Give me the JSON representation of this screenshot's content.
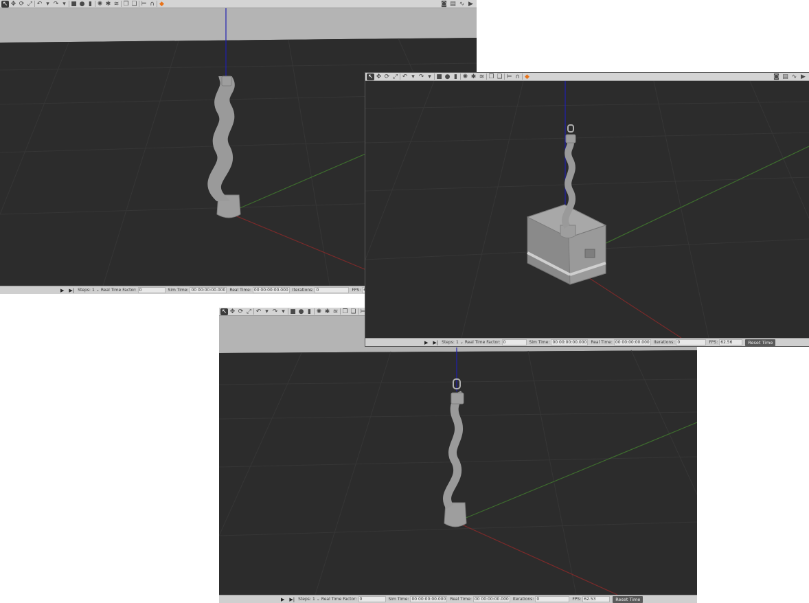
{
  "toolbar": {
    "tools": [
      {
        "icon": "select-arrow-icon",
        "glyph": "↖"
      },
      {
        "icon": "translate-icon",
        "glyph": "✥"
      },
      {
        "icon": "rotate-icon",
        "glyph": "⟳"
      },
      {
        "icon": "scale-icon",
        "glyph": "⤢"
      },
      {
        "icon": "undo-icon",
        "glyph": "↶"
      },
      {
        "icon": "undo-dropdown-icon",
        "glyph": "▾"
      },
      {
        "icon": "redo-icon",
        "glyph": "↷"
      },
      {
        "icon": "redo-dropdown-icon",
        "glyph": "▾"
      },
      {
        "icon": "box-shape-icon",
        "glyph": "■"
      },
      {
        "icon": "sphere-shape-icon",
        "glyph": "●"
      },
      {
        "icon": "cylinder-shape-icon",
        "glyph": "▮"
      },
      {
        "icon": "point-light-icon",
        "glyph": "✺"
      },
      {
        "icon": "spot-light-icon",
        "glyph": "✱"
      },
      {
        "icon": "directional-light-icon",
        "glyph": "≋"
      },
      {
        "icon": "copy-icon",
        "glyph": "❐"
      },
      {
        "icon": "paste-icon",
        "glyph": "❏"
      },
      {
        "icon": "align-icon",
        "glyph": "⊨"
      },
      {
        "icon": "snap-icon",
        "glyph": "∩"
      },
      {
        "icon": "view-angle-icon",
        "glyph": "◆"
      }
    ],
    "right_tools": [
      {
        "icon": "screenshot-icon",
        "glyph": "◙"
      },
      {
        "icon": "log-icon",
        "glyph": "▤"
      },
      {
        "icon": "plot-icon",
        "glyph": "∿"
      },
      {
        "icon": "record-video-icon",
        "glyph": "▶"
      }
    ]
  },
  "status": {
    "steps_label": "Steps:",
    "steps_value": "1",
    "rtf_label": "Real Time Factor:",
    "rtf_value": "0",
    "sim_time_label": "Sim Time:",
    "sim_time_value": "00 00:00:00.000",
    "real_time_label": "Real Time:",
    "real_time_value": "00 00:00:00.000",
    "iterations_label": "Iterations:",
    "iterations_value": "0",
    "fps_label": "FPS:",
    "reset_label": "Reset Time"
  },
  "windows": {
    "w1": {
      "fps": "62..."
    },
    "w2": {
      "fps": "62.56"
    },
    "w3": {
      "fps": "62.53"
    }
  },
  "colors": {
    "ground": "#2c2c2c",
    "sky": "#b4b4b4",
    "grid": "#3a3a3a",
    "axis_x": "#7a2a2a",
    "axis_y": "#3e6e2e",
    "axis_z": "#2020b0",
    "robot": "#9e9e9e"
  }
}
